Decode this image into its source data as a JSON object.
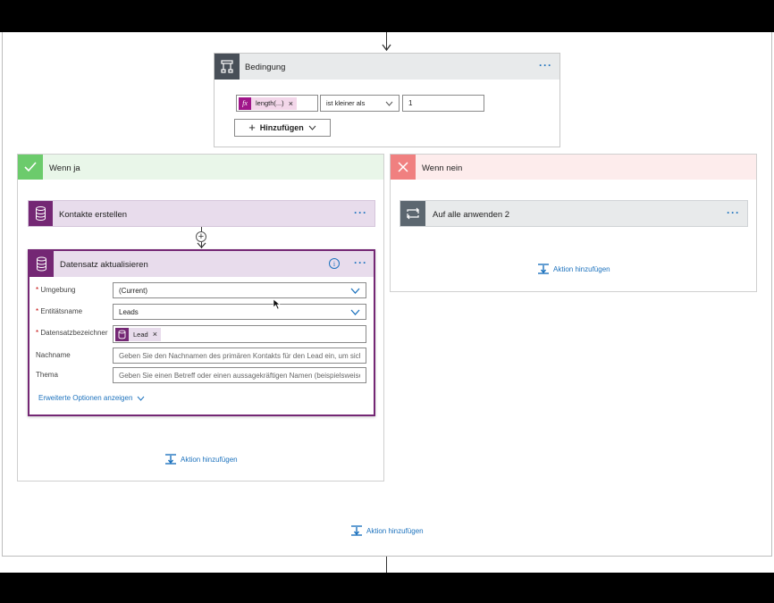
{
  "condition": {
    "title": "Bedingung",
    "token_label": "length(...)",
    "operator": "ist kleiner als",
    "value": "1",
    "add_label": "Hinzufügen"
  },
  "branch_yes": {
    "title": "Wenn ja",
    "create_contacts": {
      "title": "Kontakte erstellen"
    },
    "update_record": {
      "title": "Datensatz aktualisieren",
      "fields": [
        {
          "label": "Umgebung",
          "required": true,
          "value": "(Current)"
        },
        {
          "label": "Entitätsname",
          "required": true,
          "value": "Leads"
        },
        {
          "label": "Datensatzbezeichner",
          "required": true,
          "token": "Lead"
        },
        {
          "label": "Nachname",
          "required": false,
          "placeholder": "Geben Sie den Nachnamen des primären Kontakts für den Lead ein, um sicher..."
        },
        {
          "label": "Thema",
          "required": false,
          "placeholder": "Geben Sie einen Betreff oder einen aussagekräftigen Namen (beispielsweise de..."
        }
      ],
      "advanced_label": "Erweiterte Optionen anzeigen"
    },
    "add_action": "Aktion hinzufügen"
  },
  "branch_no": {
    "title": "Wenn nein",
    "apply_to_each": {
      "title": "Auf alle anwenden 2"
    },
    "add_action": "Aktion hinzufügen"
  },
  "bottom_add_action": "Aktion hinzufügen",
  "colors": {
    "condition_icon": "#484f58",
    "yes_header": "#e9f6e9",
    "yes_icon": "#6ccb6c",
    "no_header": "#fdecec",
    "no_icon": "#f08080",
    "dataverse_header": "#e8dcec",
    "dataverse_icon": "#742774",
    "apply_header": "#e8eaeb",
    "apply_icon": "#5c6770",
    "link": "#1e73be"
  },
  "icons": [
    "condition-icon",
    "fx-icon",
    "close-icon",
    "chevron-down-icon",
    "plus-icon",
    "check-icon",
    "x-icon",
    "database-icon",
    "info-icon",
    "loop-icon",
    "insert-action-icon",
    "more-icon",
    "mouse-cursor"
  ]
}
